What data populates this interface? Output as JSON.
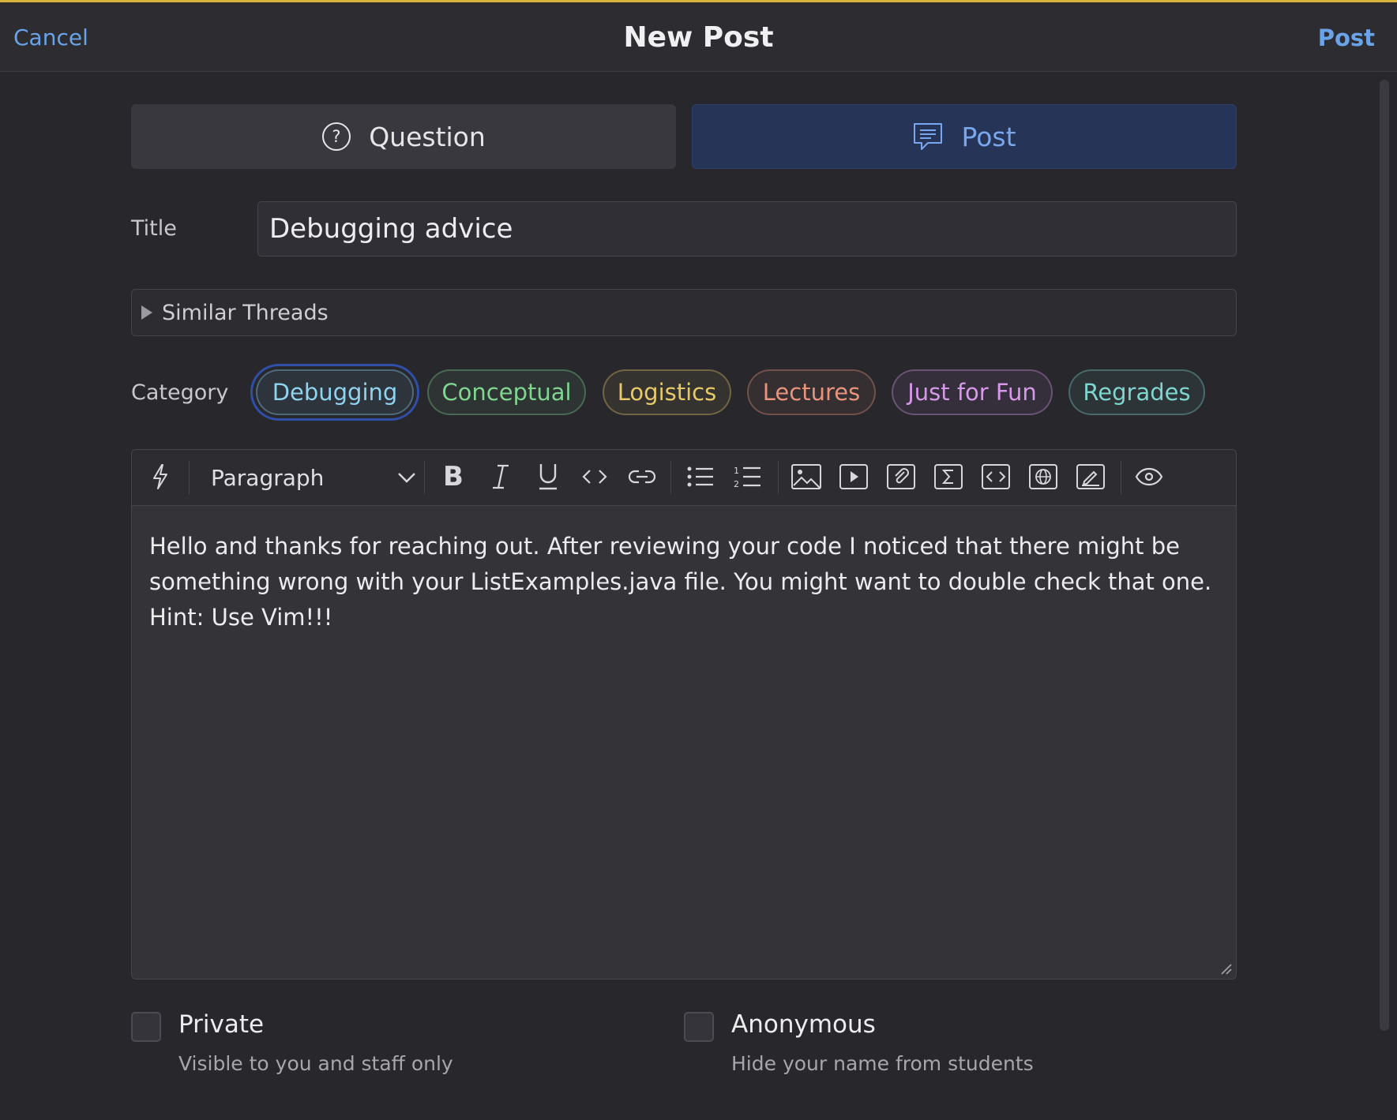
{
  "header": {
    "cancel": "Cancel",
    "title": "New Post",
    "post": "Post"
  },
  "post_type": {
    "question": "Question",
    "post": "Post",
    "selected": "Post"
  },
  "title_field": {
    "label": "Title",
    "value": "Debugging advice"
  },
  "similar_threads": {
    "label": "Similar Threads"
  },
  "category": {
    "label": "Category",
    "selected": "Debugging",
    "items": [
      {
        "label": "Debugging",
        "color": "#8fd3f0"
      },
      {
        "label": "Conceptual",
        "color": "#7fd68f"
      },
      {
        "label": "Logistics",
        "color": "#e8c96a"
      },
      {
        "label": "Lectures",
        "color": "#e8937c"
      },
      {
        "label": "Just for Fun",
        "color": "#d698e8"
      },
      {
        "label": "Regrades",
        "color": "#7fd6cf"
      }
    ]
  },
  "editor": {
    "block_format": "Paragraph",
    "toolbar_icons": [
      "lightning-icon",
      "bold-icon",
      "italic-icon",
      "underline-icon",
      "inline-code-icon",
      "link-icon",
      "bullet-list-icon",
      "numbered-list-icon",
      "image-icon",
      "video-icon",
      "attachment-icon",
      "math-icon",
      "code-block-icon",
      "web-embed-icon",
      "drawing-icon",
      "preview-icon"
    ],
    "content_lines": [
      "Hello and thanks for reaching out. After reviewing your code I noticed that there might be",
      "something wrong with your ListExamples.java file. You might want to double check that one.",
      "Hint: Use Vim!!!"
    ]
  },
  "options": {
    "private": {
      "label": "Private",
      "description": "Visible to you and staff only",
      "checked": false
    },
    "anonymous": {
      "label": "Anonymous",
      "description": "Hide your name from students",
      "checked": false
    }
  },
  "colors": {
    "accent": "#6aa3e8",
    "top_border": "#d9b43c",
    "selected_ring": "#2f4fa8"
  }
}
